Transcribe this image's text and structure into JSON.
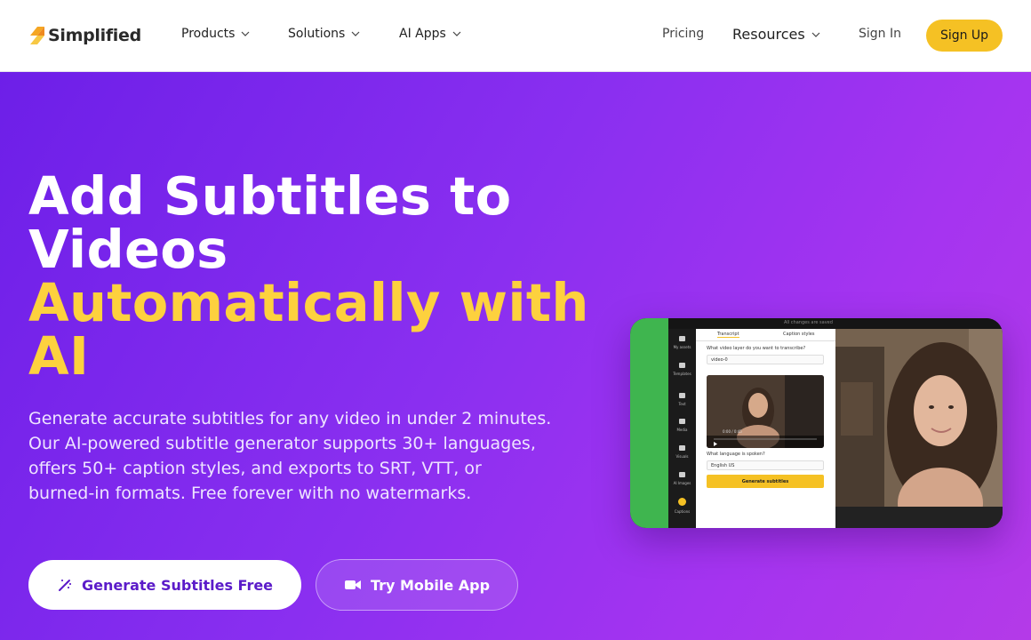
{
  "nav": {
    "brand": "Simplified",
    "products": "Products",
    "solutions": "Solutions",
    "ai_apps": "AI Apps",
    "pricing": "Pricing",
    "resources": "Resources",
    "sign_in": "Sign In",
    "sign_up": "Sign Up"
  },
  "hero": {
    "title_line1": "Add Subtitles to",
    "title_line2": "Videos",
    "title_highlight1": "Automatically with",
    "title_highlight2": "AI",
    "description": "Generate accurate subtitles for any video in under 2 minutes. Our AI-powered subtitle generator supports 30+ languages, offers 50+ caption styles, and exports to SRT, VTT, or burned-in formats. Free forever with no watermarks.",
    "primary_cta": "Generate Subtitles Free",
    "secondary_cta": "Try Mobile App"
  },
  "preview": {
    "top_status": "All changes are saved",
    "tab_transcript": "Transcript",
    "tab_caption_styles": "Caption styles",
    "q_video_layer": "What video layer do you want to transcribe?",
    "video_select": "video-0",
    "player_time": "0:00 / 0:45",
    "q_language": "What language is spoken?",
    "language_select": "English US",
    "generate_button": "Generate subtitles",
    "sidebar": [
      "My assets",
      "Templates",
      "Text",
      "Media",
      "Visuals",
      "AI Images",
      "Captions"
    ]
  },
  "colors": {
    "accent_yellow": "#f5c124",
    "headline_yellow": "#fdd13e",
    "hero_purple_start": "#6d1fe8",
    "hero_purple_end": "#b43ae8",
    "button_text_purple": "#5b1bc9",
    "preview_green": "#3fb54f"
  },
  "icons": {
    "logo": "simplified-logo-icon",
    "chevron": "chevron-down-icon",
    "magic_wand": "magic-wand-icon",
    "video_camera": "video-camera-icon"
  }
}
